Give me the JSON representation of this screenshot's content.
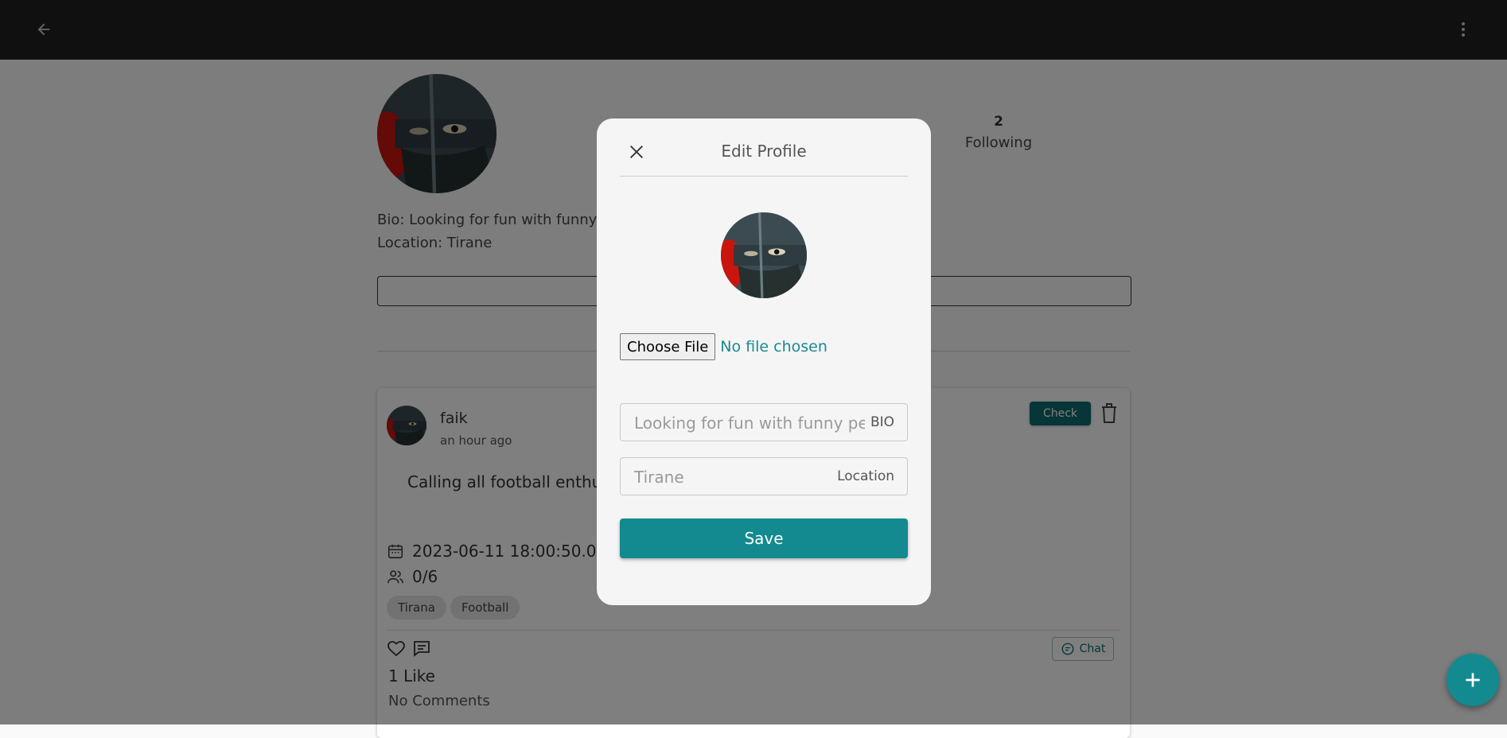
{
  "appbar": {
    "back_icon": "arrow-left-icon",
    "menu_icon": "more-vert-icon"
  },
  "profile": {
    "stats": [
      {
        "value": "",
        "label": ""
      },
      {
        "value": "2",
        "label": "Following"
      }
    ],
    "bio": "Bio: Looking for fun with funny peo",
    "location": "Location: Tirane"
  },
  "post": {
    "author": "faik",
    "time": "an hour ago",
    "check_label": "Check",
    "body": "Calling all football enthus                                                                                                                      ay. Bring your A-game",
    "date": "2023-06-11 18:00:50.0",
    "participants": "0/6",
    "tags": [
      "Tirana",
      "Football"
    ],
    "chat_label": "Chat",
    "likes": "1 Like",
    "comments": "No Comments"
  },
  "dialog": {
    "title": "Edit Profile",
    "file_button": "Choose File",
    "file_status": "No file chosen",
    "bio_placeholder": "Looking for fun with funny peop",
    "bio_adorn": "BIO",
    "location_placeholder": "Tirane",
    "location_adorn": "Location",
    "save_label": "Save"
  },
  "colors": {
    "accent": "#128a90",
    "appbar": "#212121",
    "check": "#0e6b70"
  }
}
